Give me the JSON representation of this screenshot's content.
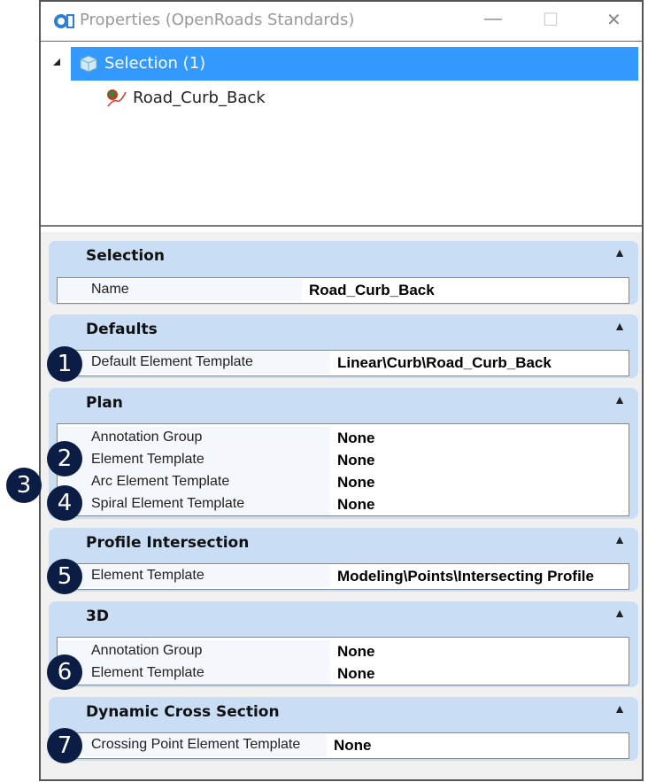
{
  "window": {
    "title": "Properties (OpenRoads Standards)",
    "minimize": "—",
    "maximize": "☐",
    "close": "✕"
  },
  "tree": {
    "root": "Selection (1)",
    "child": "Road_Curb_Back"
  },
  "sections": [
    {
      "title": "Selection",
      "rows": [
        {
          "label": "Name",
          "value": "Road_Curb_Back"
        }
      ]
    },
    {
      "title": "Defaults",
      "rows": [
        {
          "label": "Default Element Template",
          "value": "Linear\\Curb\\Road_Curb_Back"
        }
      ]
    },
    {
      "title": "Plan",
      "rows": [
        {
          "label": "Annotation Group",
          "value": "None"
        },
        {
          "label": "Element Template",
          "value": "None"
        },
        {
          "label": "Arc Element Template",
          "value": "None"
        },
        {
          "label": "Spiral Element Template",
          "value": "None"
        }
      ]
    },
    {
      "title": "Profile Intersection",
      "rows": [
        {
          "label": "Element Template",
          "value": "Modeling\\Points\\Intersecting Profile"
        }
      ]
    },
    {
      "title": "3D",
      "rows": [
        {
          "label": "Annotation Group",
          "value": "None"
        },
        {
          "label": "Element Template",
          "value": "None"
        }
      ]
    },
    {
      "title": "Dynamic Cross Section",
      "rows": [
        {
          "label": "Crossing Point Element Template",
          "value": "None"
        }
      ]
    }
  ],
  "callouts": [
    "1",
    "2",
    "3",
    "4",
    "5",
    "6",
    "7"
  ],
  "colors": {
    "selection": "#3399ff",
    "header": "#c9def5",
    "callout": "#0b1d44"
  }
}
